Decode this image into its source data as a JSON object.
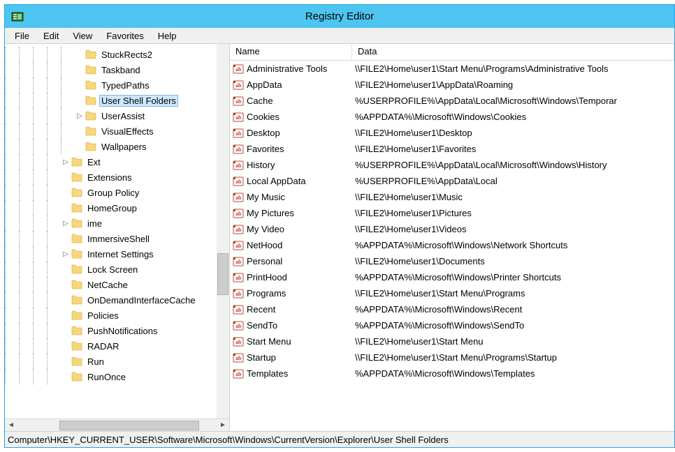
{
  "window": {
    "title": "Registry Editor"
  },
  "menus": [
    "File",
    "Edit",
    "View",
    "Favorites",
    "Help"
  ],
  "tree": [
    {
      "indent": 5,
      "expander": "",
      "label": "StuckRects2",
      "selected": false
    },
    {
      "indent": 5,
      "expander": "",
      "label": "Taskband",
      "selected": false
    },
    {
      "indent": 5,
      "expander": "",
      "label": "TypedPaths",
      "selected": false
    },
    {
      "indent": 5,
      "expander": "",
      "label": "User Shell Folders",
      "selected": true
    },
    {
      "indent": 5,
      "expander": "▷",
      "label": "UserAssist",
      "selected": false
    },
    {
      "indent": 5,
      "expander": "",
      "label": "VisualEffects",
      "selected": false
    },
    {
      "indent": 5,
      "expander": "",
      "label": "Wallpapers",
      "selected": false
    },
    {
      "indent": 4,
      "expander": "▷",
      "label": "Ext",
      "selected": false
    },
    {
      "indent": 4,
      "expander": "",
      "label": "Extensions",
      "selected": false
    },
    {
      "indent": 4,
      "expander": "",
      "label": "Group Policy",
      "selected": false
    },
    {
      "indent": 4,
      "expander": "",
      "label": "HomeGroup",
      "selected": false
    },
    {
      "indent": 4,
      "expander": "▷",
      "label": "ime",
      "selected": false
    },
    {
      "indent": 4,
      "expander": "",
      "label": "ImmersiveShell",
      "selected": false
    },
    {
      "indent": 4,
      "expander": "▷",
      "label": "Internet Settings",
      "selected": false
    },
    {
      "indent": 4,
      "expander": "",
      "label": "Lock Screen",
      "selected": false
    },
    {
      "indent": 4,
      "expander": "",
      "label": "NetCache",
      "selected": false
    },
    {
      "indent": 4,
      "expander": "",
      "label": "OnDemandInterfaceCache",
      "selected": false
    },
    {
      "indent": 4,
      "expander": "",
      "label": "Policies",
      "selected": false
    },
    {
      "indent": 4,
      "expander": "",
      "label": "PushNotifications",
      "selected": false
    },
    {
      "indent": 4,
      "expander": "",
      "label": "RADAR",
      "selected": false
    },
    {
      "indent": 4,
      "expander": "",
      "label": "Run",
      "selected": false
    },
    {
      "indent": 4,
      "expander": "",
      "label": "RunOnce",
      "selected": false
    }
  ],
  "columns": {
    "name": "Name",
    "data": "Data"
  },
  "values": [
    {
      "name": "Administrative Tools",
      "data": "\\\\FILE2\\Home\\user1\\Start Menu\\Programs\\Administrative Tools"
    },
    {
      "name": "AppData",
      "data": "\\\\FILE2\\Home\\user1\\AppData\\Roaming"
    },
    {
      "name": "Cache",
      "data": "%USERPROFILE%\\AppData\\Local\\Microsoft\\Windows\\Temporar"
    },
    {
      "name": "Cookies",
      "data": "%APPDATA%\\Microsoft\\Windows\\Cookies"
    },
    {
      "name": "Desktop",
      "data": "\\\\FILE2\\Home\\user1\\Desktop"
    },
    {
      "name": "Favorites",
      "data": "\\\\FILE2\\Home\\user1\\Favorites"
    },
    {
      "name": "History",
      "data": "%USERPROFILE%\\AppData\\Local\\Microsoft\\Windows\\History"
    },
    {
      "name": "Local AppData",
      "data": "%USERPROFILE%\\AppData\\Local"
    },
    {
      "name": "My Music",
      "data": "\\\\FILE2\\Home\\user1\\Music"
    },
    {
      "name": "My Pictures",
      "data": "\\\\FILE2\\Home\\user1\\Pictures"
    },
    {
      "name": "My Video",
      "data": "\\\\FILE2\\Home\\user1\\Videos"
    },
    {
      "name": "NetHood",
      "data": "%APPDATA%\\Microsoft\\Windows\\Network Shortcuts"
    },
    {
      "name": "Personal",
      "data": "\\\\FILE2\\Home\\user1\\Documents"
    },
    {
      "name": "PrintHood",
      "data": "%APPDATA%\\Microsoft\\Windows\\Printer Shortcuts"
    },
    {
      "name": "Programs",
      "data": "\\\\FILE2\\Home\\user1\\Start Menu\\Programs"
    },
    {
      "name": "Recent",
      "data": "%APPDATA%\\Microsoft\\Windows\\Recent"
    },
    {
      "name": "SendTo",
      "data": "%APPDATA%\\Microsoft\\Windows\\SendTo"
    },
    {
      "name": "Start Menu",
      "data": "\\\\FILE2\\Home\\user1\\Start Menu"
    },
    {
      "name": "Startup",
      "data": "\\\\FILE2\\Home\\user1\\Start Menu\\Programs\\Startup"
    },
    {
      "name": "Templates",
      "data": "%APPDATA%\\Microsoft\\Windows\\Templates"
    }
  ],
  "statusbar": "Computer\\HKEY_CURRENT_USER\\Software\\Microsoft\\Windows\\CurrentVersion\\Explorer\\User Shell Folders"
}
